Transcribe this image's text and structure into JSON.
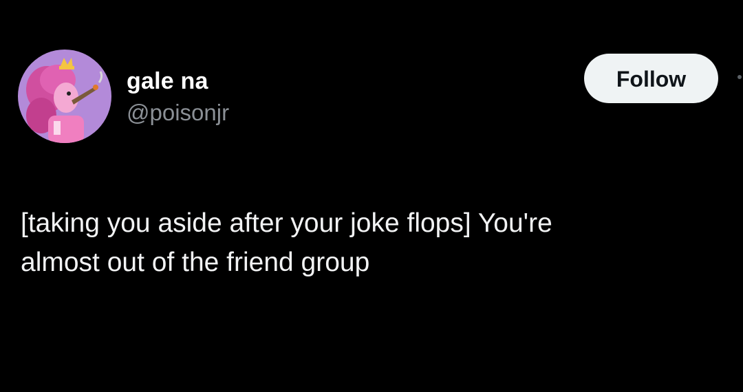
{
  "author": {
    "display_name": "gale na",
    "handle": "@poisonjr",
    "avatar_icon": "princess-bubblegum-avatar"
  },
  "follow_button": {
    "label": "Follow"
  },
  "tweet": {
    "text": "[taking you aside after your joke flops] You're\nalmost out of the friend group"
  },
  "colors": {
    "background": "#000000",
    "name": "#ffffff",
    "handle": "#8b9096",
    "text": "#f2f3f4",
    "button_bg": "#eff3f4",
    "button_text": "#0f1419",
    "avatar_bg": "#b38ad9"
  }
}
